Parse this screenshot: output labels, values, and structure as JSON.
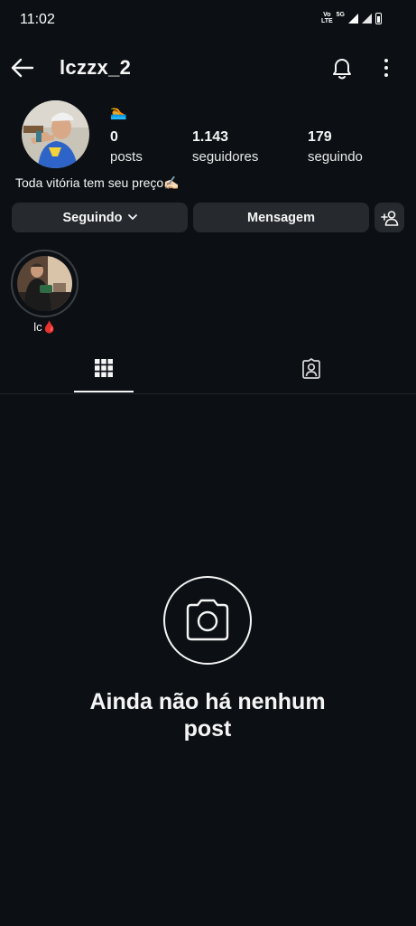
{
  "status_bar": {
    "time": "11:02",
    "volte_label": "Vo\nLTE",
    "network_label": "5G"
  },
  "header": {
    "username": "lczzx_2"
  },
  "profile": {
    "badge_emoji": "🏊",
    "stats": [
      {
        "value": "0",
        "label": "posts"
      },
      {
        "value": "1.143",
        "label": "seguidores"
      },
      {
        "value": "179",
        "label": "seguindo"
      }
    ],
    "bio": "Toda vitória tem seu preço✍🏻"
  },
  "actions": {
    "follow_label": "Seguindo",
    "message_label": "Mensagem"
  },
  "highlights": [
    {
      "label": "lc🩸"
    }
  ],
  "empty_state": {
    "title_line1": "Ainda não há nenhum",
    "title_line2": "post"
  },
  "colors": {
    "background": "#0c1014",
    "button": "#262a2f",
    "text": "#f5f5f5"
  }
}
